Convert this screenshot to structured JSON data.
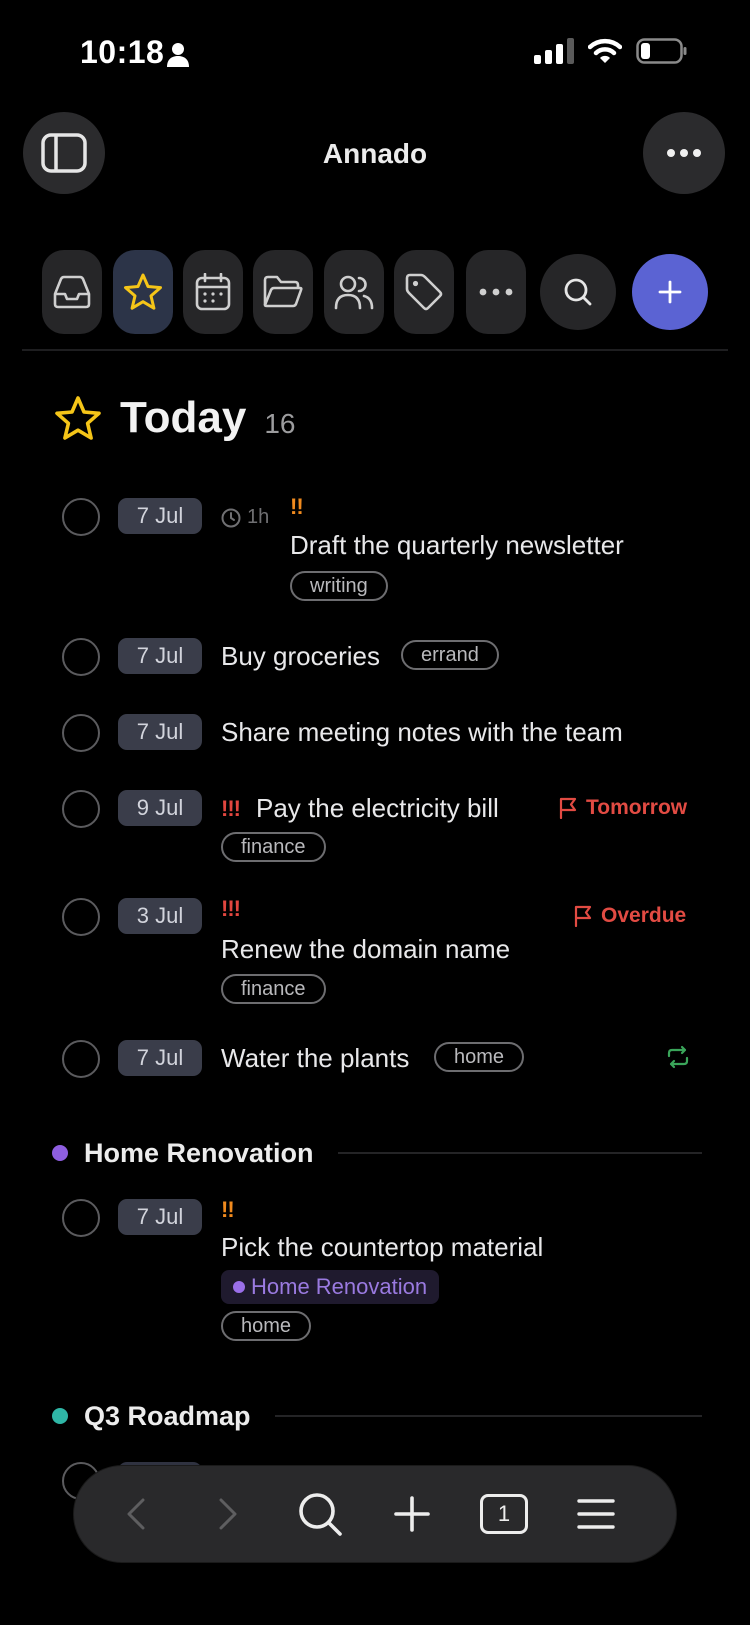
{
  "status": {
    "time": "10:18"
  },
  "app": {
    "title": "Annado"
  },
  "toolbar": {
    "icons": [
      "inbox-icon",
      "star-icon",
      "calendar-icon",
      "folder-icon",
      "people-icon",
      "tag-icon",
      "more-icon"
    ],
    "active": "star-icon"
  },
  "today": {
    "title": "Today",
    "count": "16"
  },
  "tasks": [
    {
      "date": "7 Jul",
      "duration": "1h",
      "priority": "!!",
      "title": "Draft the quarterly newsletter",
      "tag": "writing"
    },
    {
      "date": "7 Jul",
      "title": "Buy groceries",
      "tag": "errand"
    },
    {
      "date": "7 Jul",
      "title": "Share meeting notes with the team"
    },
    {
      "date": "9 Jul",
      "priority": "!!!",
      "title": "Pay the electricity bill",
      "flag": "Tomorrow",
      "tag": "finance"
    },
    {
      "date": "3 Jul",
      "priority": "!!!",
      "title": "Renew the domain name",
      "flag": "Overdue",
      "tag": "finance"
    },
    {
      "date": "7 Jul",
      "title": "Water the plants",
      "tag": "home",
      "repeat": true
    }
  ],
  "sections": [
    {
      "title": "Home Renovation",
      "color": "#8e5ee0",
      "tasks": [
        {
          "date": "7 Jul",
          "priority": "!!",
          "title": "Pick the countertop material",
          "project": "Home Renovation",
          "tag": "home"
        }
      ]
    },
    {
      "title": "Q3 Roadmap",
      "color": "#2fb6a6"
    }
  ],
  "bottom_bar": {
    "tab_count": "1"
  },
  "colors": {
    "accent": "#5b63d3",
    "star": "#f5c518",
    "overdue": "#e24b43",
    "priority_orange": "#f08a1e"
  }
}
